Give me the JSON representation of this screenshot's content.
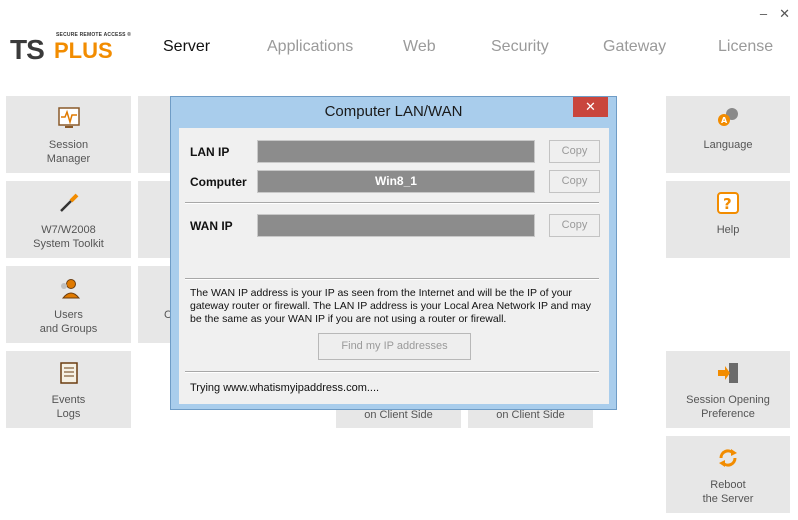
{
  "window": {
    "minimize": "–",
    "close": "✕"
  },
  "logo": {
    "ts": "TS",
    "plus": "PLUS",
    "tagline": "SECURE REMOTE ACCESS ®"
  },
  "nav": {
    "tabs": [
      {
        "label": "Server"
      },
      {
        "label": "Applications"
      },
      {
        "label": "Web"
      },
      {
        "label": "Security"
      },
      {
        "label": "Gateway"
      },
      {
        "label": "License"
      }
    ]
  },
  "tiles": {
    "session_manager": "Session\nManager",
    "system_toolkit": "W7/W2008\nSystem Toolkit",
    "users_groups": "Users\nand Groups",
    "events_logs": "Events\nLogs",
    "language": "Language",
    "help": "Help",
    "session_opening": "Session Opening\nPreference",
    "reboot": "Reboot\nthe Server",
    "client_side_1": "on Client Side",
    "client_side_2": "on Client Side",
    "partial_c": "C"
  },
  "dialog": {
    "title": "Computer LAN/WAN",
    "close": "✕",
    "lan_label": "LAN IP",
    "lan_value": "",
    "computer_label": "Computer",
    "computer_value": "Win8_1",
    "wan_label": "WAN IP",
    "wan_value": "",
    "copy_label": "Copy",
    "info": "The WAN IP address is your IP as seen from the Internet and will be the IP of your gateway router or firewall. The LAN IP address is your Local Area Network IP and may be the same as your WAN IP if you are not using a router or firewall.",
    "find_button": "Find my IP addresses",
    "status": "Trying www.whatismyipaddress.com...."
  },
  "colors": {
    "accent": "#f28c00",
    "tile_bg": "#e7e7e7",
    "dialog_frame": "#a9cdec",
    "close_red": "#c9463d"
  }
}
